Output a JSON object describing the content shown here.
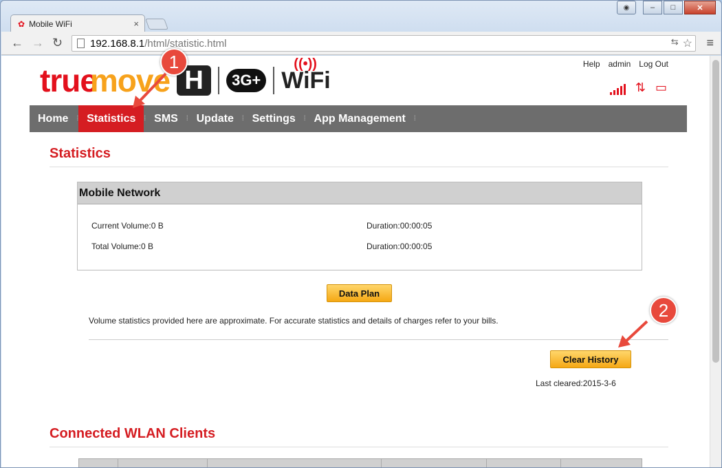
{
  "browser": {
    "tab_title": "Mobile WiFi",
    "tab_close": "×",
    "url_host": "192.168.8.1",
    "url_path": "/html/statistic.html",
    "back": "←",
    "forward": "→",
    "reload": "↻",
    "menu": "≡",
    "star": "☆",
    "translate": "⇆",
    "min": "–",
    "max": "□",
    "close": "✕",
    "user": "👤"
  },
  "brand": {
    "true": "true",
    "move": "move",
    "h": "H",
    "threeg": "3G+",
    "wifi": "WiFi"
  },
  "toplinks": [
    "Help",
    "admin",
    "Log Out"
  ],
  "nav": {
    "items": [
      "Home",
      "Statistics",
      "SMS",
      "Update",
      "Settings",
      "App Management"
    ],
    "active": "Statistics"
  },
  "statistics": {
    "heading": "Statistics",
    "panel_title": "Mobile Network",
    "current_volume": "Current Volume:0 B",
    "current_duration": "Duration:00:00:05",
    "total_volume": "Total Volume:0 B",
    "total_duration": "Duration:00:00:05",
    "data_plan_button": "Data Plan",
    "note": "Volume statistics provided here are approximate. For accurate statistics and details of charges refer to your bills.",
    "clear_history_button": "Clear History",
    "last_cleared": "Last cleared:2015-3-6"
  },
  "wlan": {
    "heading": "Connected WLAN Clients"
  },
  "annotations": {
    "badge1": "1",
    "badge2": "2",
    "color": "#e8493c"
  }
}
